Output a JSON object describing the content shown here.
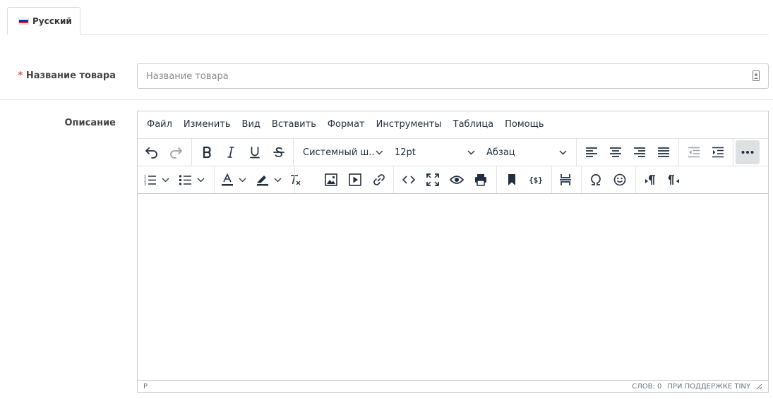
{
  "tabs": [
    {
      "label": "Русский",
      "active": true,
      "flag_colors": [
        "#ffffff",
        "#0039a6",
        "#d52b1e"
      ]
    }
  ],
  "product_name": {
    "label": "Название товара",
    "required_mark": "*",
    "placeholder": "Название товара",
    "value": ""
  },
  "description": {
    "label": "Описание"
  },
  "editor": {
    "menu": [
      "Файл",
      "Изменить",
      "Вид",
      "Вставить",
      "Формат",
      "Инструменты",
      "Таблица",
      "Помощь"
    ],
    "font_family": "Системный ш...",
    "font_size": "12pt",
    "block_format": "Абзац",
    "toolbar_row1_icons": [
      "undo-icon",
      "redo-icon",
      "bold-icon",
      "italic-icon",
      "underline-icon",
      "strikethrough-icon",
      "align-left-icon",
      "align-center-icon",
      "align-right-icon",
      "align-justify-icon",
      "outdent-icon",
      "indent-icon",
      "more-icon"
    ],
    "toolbar_row2_icons": [
      "numbered-list-icon",
      "bullet-list-icon",
      "text-color-icon",
      "highlight-icon",
      "clear-formatting-icon",
      "image-icon",
      "media-icon",
      "link-icon",
      "code-icon",
      "fullscreen-icon",
      "preview-icon",
      "print-icon",
      "bookmark-icon",
      "template-icon",
      "page-break-icon",
      "special-char-icon",
      "emoji-icon",
      "ltr-icon",
      "rtl-icon"
    ],
    "status_path": "P",
    "word_count": "СЛОВ: 0",
    "branding": "ПРИ ПОДДЕРЖКЕ TINY",
    "text_color_accent": "#222f3e",
    "active_button_bg": "#dee0e2"
  },
  "colors": {
    "required": "#d9534f",
    "border": "#cccccc"
  }
}
